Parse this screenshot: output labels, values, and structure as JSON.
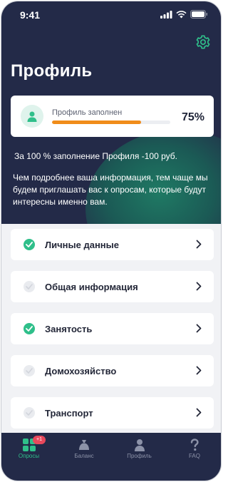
{
  "status_bar": {
    "time": "9:41"
  },
  "header": {
    "title": "Профиль"
  },
  "progress": {
    "label": "Профиль заполнен",
    "percent_text": "75%",
    "fraction": 0.75,
    "fill_color": "#f08c1a"
  },
  "bonus_text": "За 100 % заполнение Профиля -100 руб.",
  "info_text": "Чем подробнее ваша информация, тем чаще мы будем приглашать вас к опросам, которые будут интересны именно вам.",
  "menu": {
    "items": [
      {
        "label": "Личные данные",
        "completed": true
      },
      {
        "label": "Общая информация",
        "completed": false
      },
      {
        "label": "Занятость",
        "completed": true
      },
      {
        "label": "Домохозяйство",
        "completed": false
      },
      {
        "label": "Транспорт",
        "completed": false
      }
    ]
  },
  "tabbar": {
    "tabs": [
      {
        "label": "Опросы",
        "icon": "surveys-icon",
        "active": true,
        "badge": "+1"
      },
      {
        "label": "Баланс",
        "icon": "wallet-icon",
        "active": false
      },
      {
        "label": "Профиль",
        "icon": "user-icon",
        "active": false
      },
      {
        "label": "FAQ",
        "icon": "question-icon",
        "active": false
      }
    ]
  },
  "colors": {
    "header_bg": "#232a48",
    "accent_green": "#2fbf8a",
    "progress_orange": "#f08c1a",
    "badge_red": "#e8485c"
  }
}
